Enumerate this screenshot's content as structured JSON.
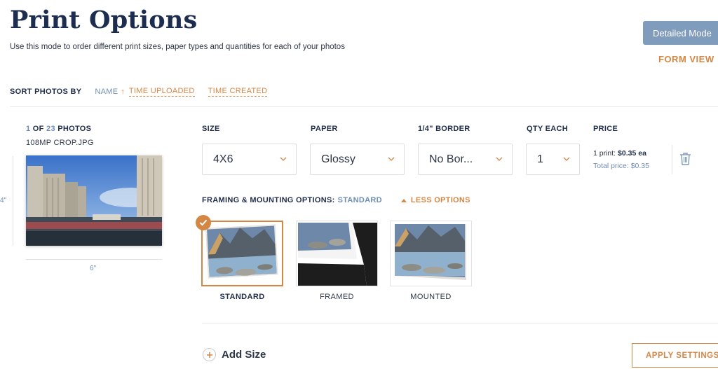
{
  "header": {
    "title": "Print Options",
    "subtitle": "Use this mode to order different print sizes, paper types and quantities for each of your photos",
    "mode_button": "Detailed Mode",
    "form_view": "FORM VIEW"
  },
  "sort": {
    "label": "SORT PHOTOS BY",
    "name": "NAME",
    "name_arrow": "↑",
    "time_uploaded": "TIME UPLOADED",
    "time_created": "TIME CREATED"
  },
  "photo": {
    "current": "1",
    "of": "OF",
    "total": "23",
    "photos_label": "PHOTOS",
    "filename": "108MP CROP.JPG",
    "height_label": "4\"",
    "width_label": "6\""
  },
  "columns": {
    "size": "SIZE",
    "paper": "PAPER",
    "border": "1/4\" BORDER",
    "qty": "QTY EACH",
    "price": "PRICE"
  },
  "selects": {
    "size": "4X6",
    "paper": "Glossy",
    "border": "No Bor...",
    "qty": "1"
  },
  "price": {
    "per_print_label": "1 print:",
    "per_print_value": "$0.35 ea",
    "total_label": "Total price:",
    "total_value": "$0.35"
  },
  "framing": {
    "label": "FRAMING & MOUNTING OPTIONS:",
    "value": "STANDARD",
    "less_options": "LESS OPTIONS",
    "options": [
      {
        "label": "STANDARD",
        "selected": true
      },
      {
        "label": "FRAMED",
        "selected": false
      },
      {
        "label": "MOUNTED",
        "selected": false
      }
    ]
  },
  "footer": {
    "add_size": "Add Size",
    "apply": "APPLY SETTINGS"
  },
  "colors": {
    "accent": "#d48745",
    "link_blue": "#6f8db4",
    "navy": "#1c2d4f",
    "mode_button_bg": "#7f9cbd"
  },
  "icons": [
    "sort-arrow-up-icon",
    "chevron-down-icon",
    "trash-icon",
    "caret-up-icon",
    "check-icon",
    "plus-icon"
  ]
}
